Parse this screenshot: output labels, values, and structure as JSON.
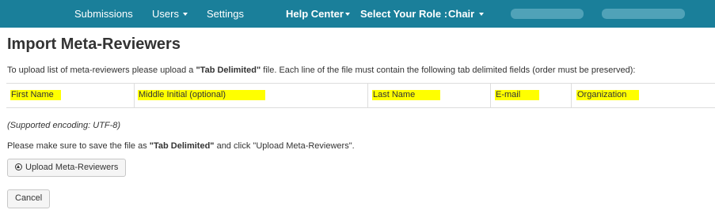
{
  "nav": {
    "submissions": "Submissions",
    "users": "Users",
    "settings": "Settings",
    "help_center": "Help Center",
    "select_role_label": "Select Your Role :",
    "role": "Chair",
    "bar_color": "#1a7f9a"
  },
  "page": {
    "title": "Import Meta-Reviewers",
    "intro": {
      "before": "To upload list of meta-reviewers please upload a ",
      "bold": "\"Tab Delimited\"",
      "after": " file. Each line of the file must contain the following tab delimited fields (order must be preserved):"
    },
    "fields": [
      "First Name",
      "Middle Initial (optional)",
      "Last Name",
      "E-mail",
      "Organization"
    ],
    "encoding_note": "(Supported encoding: UTF-8)",
    "save_note": {
      "before": "Please make sure to save the file as ",
      "bold": "\"Tab Delimited\"",
      "after": " and click \"Upload Meta-Reviewers\"."
    },
    "upload_button": "Upload Meta-Reviewers",
    "cancel_button": "Cancel",
    "highlight_color": "#ffff00"
  }
}
